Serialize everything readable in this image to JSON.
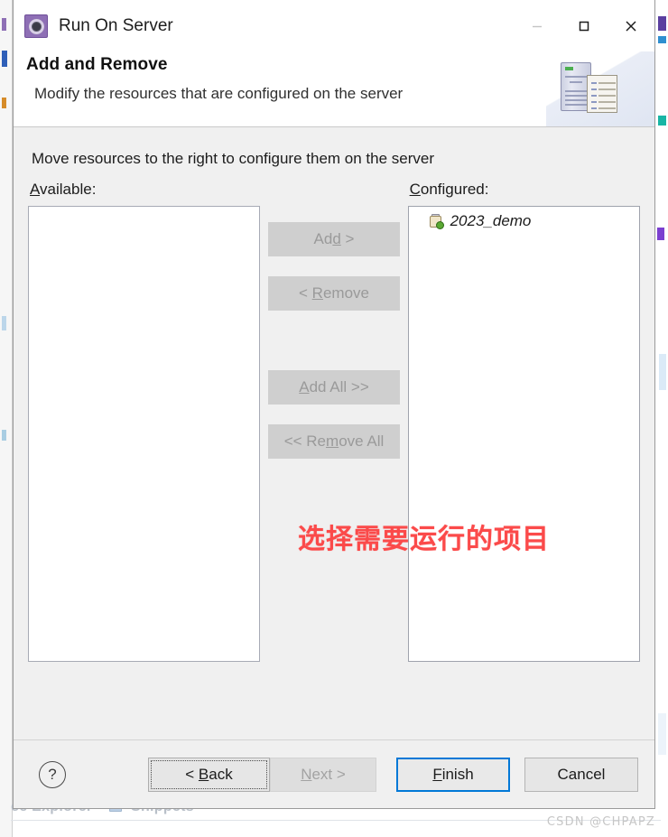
{
  "window": {
    "title": "Run On Server",
    "icon": "run-on-server-icon",
    "minimize_label": "—",
    "maximize_label": "□",
    "close_label": "✕"
  },
  "header": {
    "title": "Add and Remove",
    "subtitle": "Modify the resources that are configured on the server",
    "art_icon": "server-and-document-icon"
  },
  "body": {
    "instruction": "Move resources to the right to configure them on the server",
    "available": {
      "label": "Available:",
      "mnemonic": "A",
      "items": []
    },
    "configured": {
      "label": "Configured:",
      "mnemonic": "C",
      "items": [
        {
          "name": "2023_demo",
          "icon": "web-module-icon"
        }
      ]
    },
    "transfer_buttons": [
      {
        "id": "add",
        "label": "Add >",
        "mnemonic": "d",
        "enabled": false
      },
      {
        "id": "remove",
        "label": "< Remove",
        "mnemonic": "R",
        "enabled": false
      },
      {
        "id": "add-all",
        "label": "Add All >>",
        "mnemonic": "A",
        "enabled": false
      },
      {
        "id": "remove-all",
        "label": "<< Remove All",
        "mnemonic": "m",
        "enabled": false
      }
    ],
    "annotation": "选择需要运行的项目",
    "annotation_color": "#fb4a4a"
  },
  "footer": {
    "help_label": "?",
    "back_label": "< Back",
    "next_label": "Next >",
    "finish_label": "Finish",
    "cancel_label": "Cancel"
  },
  "background": {
    "tab_left": "ce Explorer",
    "tab_right": "Snippets",
    "watermark": "CSDN @CHPAPZ"
  }
}
